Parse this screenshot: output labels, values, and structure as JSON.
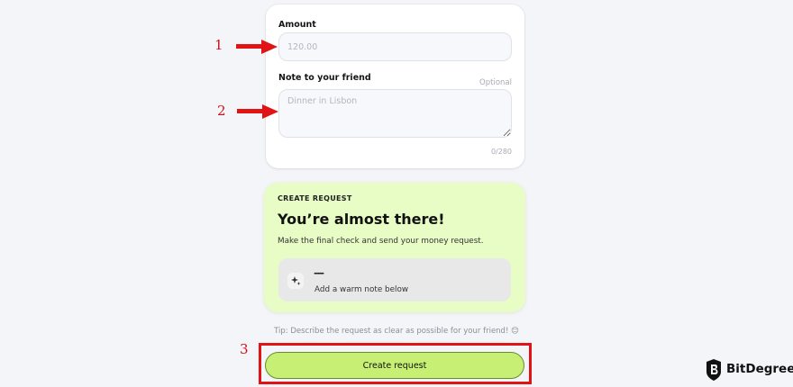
{
  "form": {
    "amount_label": "Amount",
    "amount_placeholder": "120.00",
    "note_label": "Note to your friend",
    "optional_label": "Optional",
    "note_placeholder": "Dinner in Lisbon",
    "char_counter": "0/280"
  },
  "summary": {
    "eyebrow": "CREATE REQUEST",
    "headline": "You’re almost there!",
    "description": "Make the final check and send your money request.",
    "note_icon": "sparkle-icon",
    "note_dash": "—",
    "note_text": "Add a warm note below"
  },
  "tip": "Tip: Describe the request as clear as possible for your friend! 😊",
  "cta_label": "Create request",
  "annotations": {
    "n1": "1",
    "n2": "2",
    "n3": "3"
  },
  "colors": {
    "accent": "#c6ef74",
    "summary_bg": "#e8fcc6",
    "annotation_red": "#e01414"
  },
  "watermark": {
    "text": "BitDegree"
  }
}
